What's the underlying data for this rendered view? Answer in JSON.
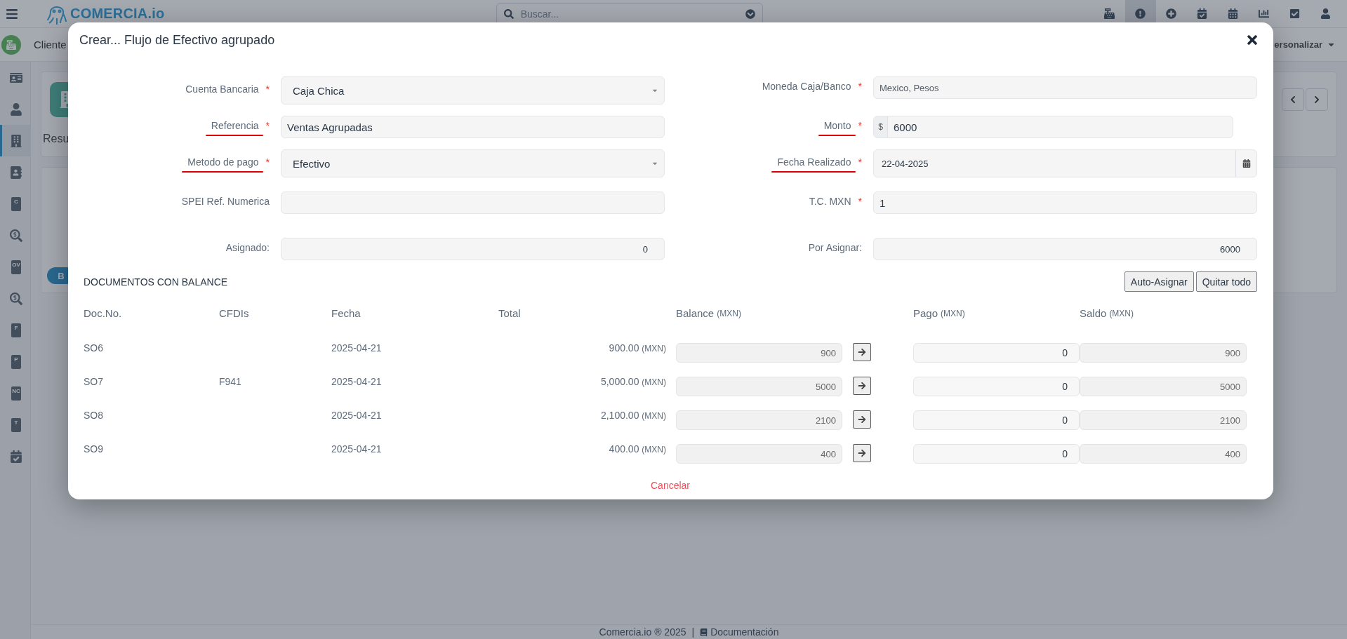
{
  "topbar": {
    "logo": "COMERCIA.io",
    "search": {
      "placeholder": "Buscar..."
    },
    "icons": [
      {
        "active": false
      },
      {
        "active": true
      },
      {
        "active": false
      },
      {
        "active": false
      },
      {
        "active": false
      },
      {
        "active": false
      },
      {
        "active": false
      },
      {
        "active": false
      }
    ]
  },
  "sidebar": {
    "items": [
      {
        "kind": "icon",
        "selected": false
      },
      {
        "kind": "icon",
        "selected": false
      },
      {
        "kind": "icon",
        "selected": true
      },
      {
        "kind": "icon",
        "selected": false
      },
      {
        "kind": "doc",
        "letter": "C",
        "selected": false
      },
      {
        "kind": "icon",
        "selected": false
      },
      {
        "kind": "doc",
        "letter": "OV",
        "selected": false
      },
      {
        "kind": "icon",
        "selected": false
      },
      {
        "kind": "doc",
        "letter": "F",
        "selected": false
      },
      {
        "kind": "doc",
        "letter": "P",
        "selected": false
      },
      {
        "kind": "doc",
        "letter": "NC",
        "selected": false
      },
      {
        "kind": "doc",
        "letter": "T",
        "selected": false
      },
      {
        "kind": "icon",
        "selected": false
      }
    ]
  },
  "breadcrumb": {
    "title": "Cliente",
    "personalize": "ersonalizar"
  },
  "page": {
    "tab": "Resu",
    "pill": "B"
  },
  "modal": {
    "title": "Crear... Flujo de Efectivo agrupado",
    "form_rows": [
      {
        "left": {
          "label": "Cuenta Bancaria",
          "asterisk": "*",
          "kind": "select",
          "value": "Caja Chica"
        },
        "right": {
          "label": "Moneda Caja/Banco",
          "asterisk": "*",
          "kind": "readonly",
          "value": "Mexico, Pesos"
        }
      },
      {
        "left": {
          "label": "Referencia",
          "asterisk": "*",
          "marked": true,
          "kind": "text",
          "value": "Ventas Agrupadas"
        },
        "right": {
          "label": "Monto",
          "asterisk": "*",
          "marked": true,
          "kind": "money",
          "prefix": "$",
          "value": "6000"
        }
      },
      {
        "left": {
          "label": "Metodo de pago",
          "asterisk": "*",
          "marked": true,
          "kind": "select",
          "value": "Efectivo"
        },
        "right": {
          "label": "Fecha Realizado",
          "asterisk": "*",
          "marked": true,
          "kind": "date",
          "value": "22-04-2025"
        }
      },
      {
        "left": {
          "label": "SPEI Ref. Numerica",
          "kind": "text"
        },
        "right": {
          "label": "T.C. MXN",
          "asterisk": "*",
          "kind": "text",
          "value": "1"
        }
      },
      {
        "left": {
          "label": "Asignado:",
          "kind": "number",
          "value": "0"
        },
        "right": {
          "label": "Por Asignar:",
          "kind": "number",
          "value": "6000"
        }
      }
    ],
    "section_title": "DOCUMENTOS CON BALANCE",
    "buttons": [
      "Auto-Asignar",
      "Quitar todo"
    ],
    "table": {
      "columns": [
        {
          "label": "Doc.No."
        },
        {
          "label": "CFDIs"
        },
        {
          "label": "Fecha"
        },
        {
          "label": "Total"
        },
        {
          "label": "Balance",
          "unit": "(MXN)"
        },
        {
          "label": "Pago",
          "unit": "(MXN)"
        },
        {
          "label": "Saldo",
          "unit": "(MXN)"
        }
      ],
      "rows": [
        {
          "doc": "SO6",
          "fecha": "2025-04-21",
          "total": "900.00",
          "total_unit": "(MXN)",
          "balance": "900",
          "pago": "0",
          "saldo": "900"
        },
        {
          "doc": "SO7",
          "cfdi": "F941",
          "fecha": "2025-04-21",
          "total": "5,000.00",
          "total_unit": "(MXN)",
          "balance": "5000",
          "pago": "0",
          "saldo": "5000"
        },
        {
          "doc": "SO8",
          "fecha": "2025-04-21",
          "total": "2,100.00",
          "total_unit": "(MXN)",
          "balance": "2100",
          "pago": "0",
          "saldo": "2100"
        },
        {
          "doc": "SO9",
          "fecha": "2025-04-21",
          "total": "400.00",
          "total_unit": "(MXN)",
          "balance": "400",
          "pago": "0",
          "saldo": "400"
        }
      ]
    },
    "cancel": "Cancelar"
  },
  "footer": {
    "copyright": "Comercia.io ® 2025",
    "separator": "|",
    "link": "Documentación"
  }
}
